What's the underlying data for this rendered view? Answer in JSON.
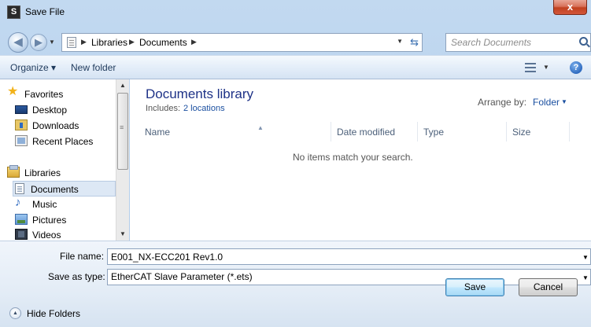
{
  "window": {
    "title": "Save File",
    "close_glyph": "x",
    "app_icon_glyph": "S"
  },
  "address": {
    "breadcrumbs": [
      "Libraries",
      "Documents"
    ],
    "search_placeholder": "Search Documents"
  },
  "toolbar": {
    "organize_label": "Organize ▾",
    "new_folder_label": "New folder",
    "help_glyph": "?"
  },
  "sidebar": {
    "items": [
      {
        "label": "Favorites",
        "icon": "star-icon"
      },
      {
        "label": "Desktop",
        "icon": "desktop-icon"
      },
      {
        "label": "Downloads",
        "icon": "downloads-icon"
      },
      {
        "label": "Recent Places",
        "icon": "recent-places-icon"
      },
      {
        "label": "Libraries",
        "icon": "libraries-icon"
      },
      {
        "label": "Documents",
        "icon": "documents-icon",
        "selected": true
      },
      {
        "label": "Music",
        "icon": "music-icon"
      },
      {
        "label": "Pictures",
        "icon": "pictures-icon"
      },
      {
        "label": "Videos",
        "icon": "videos-icon"
      }
    ]
  },
  "library": {
    "title": "Documents library",
    "includes_label": "Includes:",
    "includes_link": "2 locations",
    "arrange_label": "Arrange by:",
    "arrange_value": "Folder"
  },
  "columns": [
    "Name",
    "Date modified",
    "Type",
    "Size"
  ],
  "empty_message": "No items match your search.",
  "form": {
    "filename_label": "File name:",
    "filename_value": "E001_NX-ECC201 Rev1.0",
    "savetype_label": "Save as type:",
    "savetype_value": "EtherCAT Slave Parameter (*.ets)"
  },
  "footer": {
    "hide_folders_label": "Hide Folders",
    "save_label": "Save",
    "cancel_label": "Cancel"
  },
  "colors": {
    "accent_link": "#1a4fa0",
    "library_title": "#1e3287",
    "close_button": "#c1411f"
  }
}
